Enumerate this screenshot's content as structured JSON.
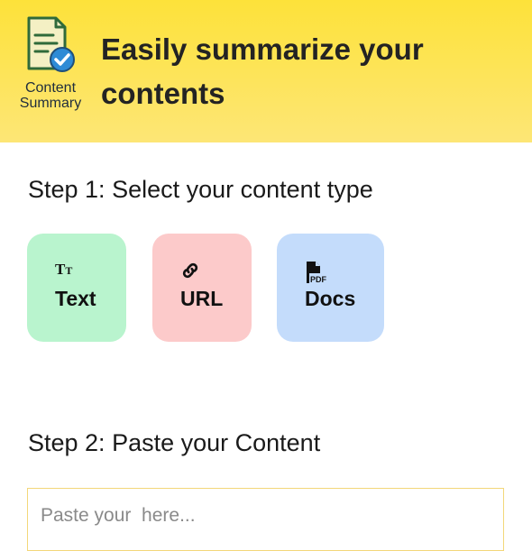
{
  "header": {
    "logo_line1": "Content",
    "logo_line2": "Summary",
    "headline": "Easily summarize your contents"
  },
  "step1": {
    "title": "Step 1: Select your content type",
    "types": [
      {
        "label": "Text",
        "icon": "text-format-icon",
        "color": "#b9f4ce"
      },
      {
        "label": "URL",
        "icon": "link-icon",
        "color": "#fccaca"
      },
      {
        "label": "Docs",
        "icon": "pdf-document-icon",
        "color": "#c4dcfb"
      }
    ]
  },
  "step2": {
    "title": "Step 2: Paste your Content",
    "placeholder": "Paste your  here..."
  },
  "colors": {
    "header_gradient_top": "#fde23a",
    "header_gradient_bottom": "#fde676",
    "input_border": "#f3d77a"
  }
}
